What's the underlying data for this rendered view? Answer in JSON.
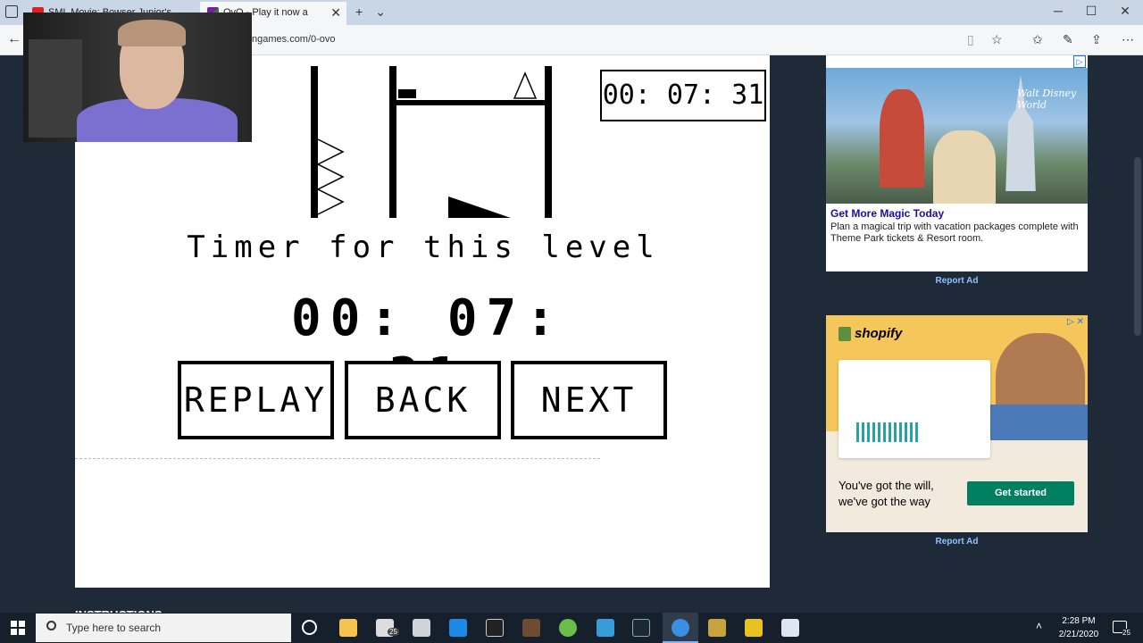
{
  "browser": {
    "tabs": [
      {
        "label": "SML Movie: Bowser Junior's"
      },
      {
        "label": "OvO - Play it now a"
      }
    ],
    "url": "ngames.com/0-ovo",
    "window_controls": {
      "minimize": "─",
      "maximize": "☐",
      "close": "✕"
    },
    "new_tab": "+",
    "tab_menu": "⌄"
  },
  "game": {
    "timer_box": "00: 07: 31",
    "timer_heading": "Timer for this level",
    "timer_value": "00: 07: 31",
    "buttons": {
      "replay": "REPLAY",
      "back": "BACK",
      "next": "NEXT"
    }
  },
  "page": {
    "instructions_heading": "INSTRUCTIONS"
  },
  "ads": {
    "label": "Ad",
    "ad1": {
      "brand": "Walt Disney World",
      "headline": "Get More Magic Today",
      "body": "Plan a magical trip with vacation packages complete with Theme Park tickets & Resort room.",
      "report": "Report Ad"
    },
    "ad2": {
      "brand": "shopify",
      "tagline": "You've got the will, we've got the way",
      "cta": "Get started",
      "report": "Report Ad"
    }
  },
  "taskbar": {
    "search_placeholder": "Type here to search",
    "time": "2:28 PM",
    "date": "2/21/2020",
    "mail_badge": "25",
    "notification_count": "25"
  },
  "colors": {
    "page_background": "#1e2a38",
    "report_ad_link": "#8ec1ff",
    "shopify_green": "#008060",
    "disney_headline": "#1a0dab"
  }
}
